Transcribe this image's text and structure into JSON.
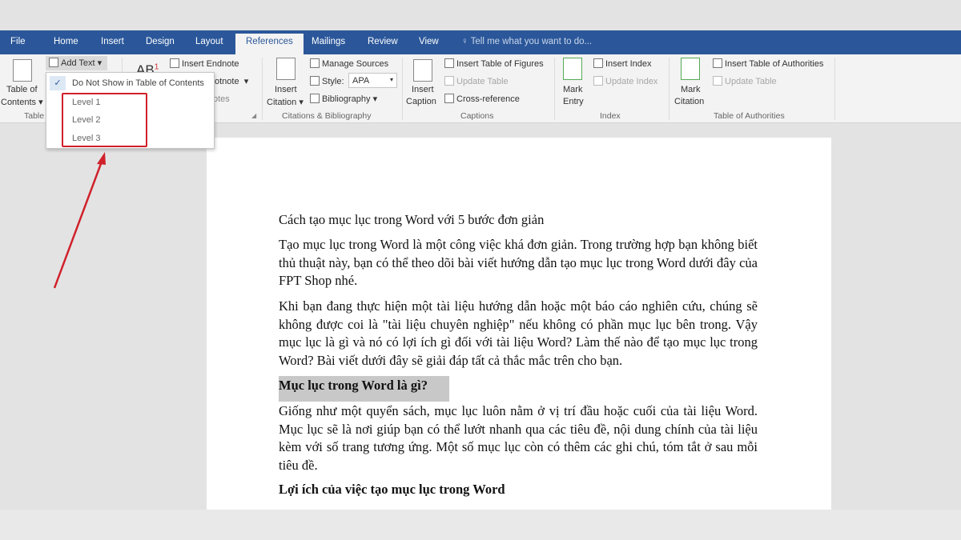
{
  "tabs": {
    "file": "File",
    "home": "Home",
    "insert": "Insert",
    "design": "Design",
    "layout": "Layout",
    "references": "References",
    "mailings": "Mailings",
    "review": "Review",
    "view": "View",
    "tellme": "Tell me what you want to do..."
  },
  "ribbon": {
    "toc": {
      "label1": "Table of",
      "label2": "Contents",
      "add_text": "Add Text",
      "group": "Table"
    },
    "footnotes": {
      "insert_endnote": "Insert Endnote",
      "next_footnote": "otnote",
      "ab": "AB",
      "sup": "1",
      "group": "otes"
    },
    "citations": {
      "insert1": "Insert",
      "insert2": "Citation",
      "manage_sources": "Manage Sources",
      "style_label": "Style:",
      "style_value": "APA",
      "bibliography": "Bibliography",
      "group": "Citations & Bibliography"
    },
    "captions": {
      "insert1": "Insert",
      "insert2": "Caption",
      "insert_tof": "Insert Table of Figures",
      "update_table": "Update Table",
      "cross_reference": "Cross-reference",
      "group": "Captions"
    },
    "index": {
      "mark1": "Mark",
      "mark2": "Entry",
      "insert_index": "Insert Index",
      "update_index": "Update Index",
      "group": "Index"
    },
    "authorities": {
      "mark1": "Mark",
      "mark2": "Citation",
      "insert_toa": "Insert Table of Authorities",
      "update_table": "Update Table",
      "group": "Table of Authorities"
    }
  },
  "menu": {
    "items": [
      "Do Not Show in Table of Contents",
      "Level 1",
      "Level 2",
      "Level 3"
    ],
    "checked": 0
  },
  "document": {
    "title": "Cách tạo mục lục trong Word với 5 bước đơn giản",
    "p1": "Tạo mục lục trong Word là một công việc khá đơn giản. Trong trường hợp bạn không biết thủ thuật này, bạn có thể theo dõi bài viết hướng dẫn tạo mục lục trong Word dưới đây của FPT Shop nhé.",
    "p2": "Khi bạn đang thực hiện một tài liệu hướng dẫn hoặc một báo cáo nghiên cứu, chúng sẽ không được coi là \"tài liệu chuyên nghiệp\" nếu không có phần mục lục bên trong. Vậy mục lục là gì và nó có lợi ích gì đối với tài liệu Word? Làm thế nào để tạo mục lục trong Word? Bài viết dưới đây sẽ giải đáp tất cả thắc mắc trên cho bạn.",
    "h1": "Mục lục trong Word là gì?",
    "p3": "Giống như một quyển sách, mục lục luôn nằm ở vị trí đầu hoặc cuối của tài liệu Word. Mục lục sẽ là nơi giúp bạn có thể lướt nhanh qua các tiêu đề, nội dung chính của tài liệu kèm với số trang tương ứng. Một số mục lục còn có thêm các ghi chú, tóm tắt ở sau mỗi tiêu đề.",
    "h2": "Lợi ích của việc tạo mục lục trong Word"
  },
  "colors": {
    "tabbar": "#2b579a",
    "highlight": "#d0202a",
    "selection": "#c8c8c8"
  }
}
